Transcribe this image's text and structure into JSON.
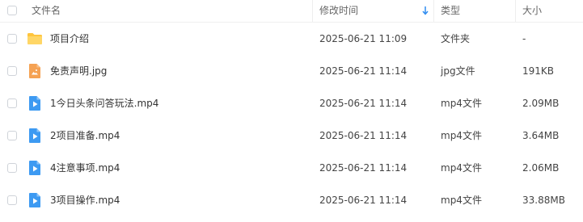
{
  "header": {
    "name": "文件名",
    "modified": "修改时间",
    "type": "类型",
    "size": "大小"
  },
  "files": [
    {
      "name": "项目介绍",
      "modified": "2025-06-21 11:09",
      "type": "文件夹",
      "size": "-",
      "icon": "folder-icon"
    },
    {
      "name": "免责声明.jpg",
      "modified": "2025-06-21 11:14",
      "type": "jpg文件",
      "size": "191KB",
      "icon": "image-file-icon"
    },
    {
      "name": "1今日头条问答玩法.mp4",
      "modified": "2025-06-21 11:14",
      "type": "mp4文件",
      "size": "2.09MB",
      "icon": "video-file-icon"
    },
    {
      "name": "2项目准备.mp4",
      "modified": "2025-06-21 11:14",
      "type": "mp4文件",
      "size": "3.64MB",
      "icon": "video-file-icon"
    },
    {
      "name": "4注意事项.mp4",
      "modified": "2025-06-21 11:14",
      "type": "mp4文件",
      "size": "2.06MB",
      "icon": "video-file-icon"
    },
    {
      "name": "3项目操作.mp4",
      "modified": "2025-06-21 11:14",
      "type": "mp4文件",
      "size": "33.88MB",
      "icon": "video-file-icon"
    }
  ],
  "colors": {
    "folder": "#ffc53d",
    "image": "#f5a253",
    "video": "#3d9af2",
    "sort_arrow": "#2f8cf0"
  }
}
